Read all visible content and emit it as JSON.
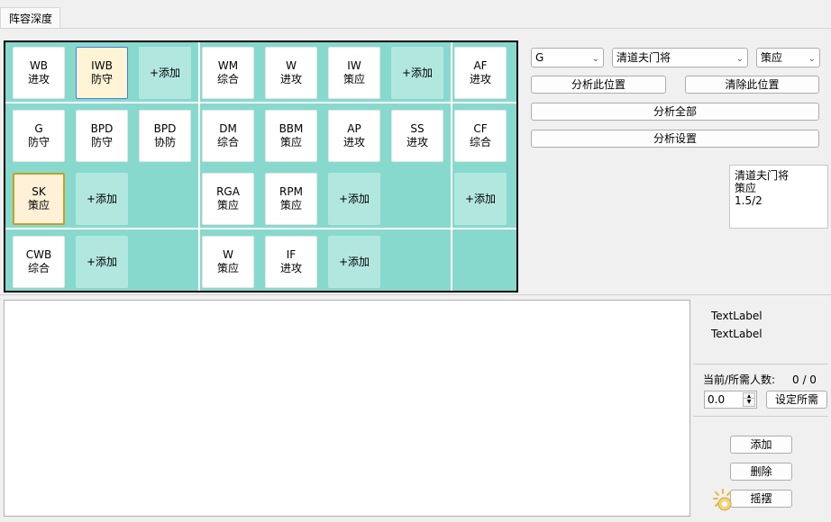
{
  "tab": {
    "label": "阵容深度"
  },
  "board": {
    "cells": [
      {
        "id": "c1",
        "line1": "WB",
        "line2": "进攻",
        "type": "player"
      },
      {
        "id": "c2",
        "line1": "IWB",
        "line2": "防守",
        "type": "selected-blue"
      },
      {
        "id": "c3",
        "line1": "+添加",
        "line2": "",
        "type": "add"
      },
      {
        "id": "c4",
        "line1": "WM",
        "line2": "综合",
        "type": "player"
      },
      {
        "id": "c5",
        "line1": "W",
        "line2": "进攻",
        "type": "player"
      },
      {
        "id": "c6",
        "line1": "IW",
        "line2": "策应",
        "type": "player"
      },
      {
        "id": "c7",
        "line1": "+添加",
        "line2": "",
        "type": "add"
      },
      {
        "id": "c8",
        "line1": "AF",
        "line2": "进攻",
        "type": "player"
      },
      {
        "id": "c9",
        "line1": "G",
        "line2": "防守",
        "type": "player"
      },
      {
        "id": "c10",
        "line1": "BPD",
        "line2": "防守",
        "type": "player"
      },
      {
        "id": "c11",
        "line1": "BPD",
        "line2": "协防",
        "type": "player"
      },
      {
        "id": "c12",
        "line1": "DM",
        "line2": "综合",
        "type": "player"
      },
      {
        "id": "c13",
        "line1": "BBM",
        "line2": "策应",
        "type": "player"
      },
      {
        "id": "c14",
        "line1": "AP",
        "line2": "进攻",
        "type": "player"
      },
      {
        "id": "c15",
        "line1": "SS",
        "line2": "进攻",
        "type": "player"
      },
      {
        "id": "c16",
        "line1": "CF",
        "line2": "综合",
        "type": "player"
      },
      {
        "id": "c17",
        "line1": "SK",
        "line2": "策应",
        "type": "selected-gold"
      },
      {
        "id": "c18",
        "line1": "+添加",
        "line2": "",
        "type": "add"
      },
      {
        "id": "c19",
        "line1": "RGA",
        "line2": "策应",
        "type": "player"
      },
      {
        "id": "c20",
        "line1": "RPM",
        "line2": "策应",
        "type": "player"
      },
      {
        "id": "c21",
        "line1": "+添加",
        "line2": "",
        "type": "add"
      },
      {
        "id": "c22",
        "line1": "+添加",
        "line2": "",
        "type": "add"
      },
      {
        "id": "c23",
        "line1": "CWB",
        "line2": "综合",
        "type": "player"
      },
      {
        "id": "c24",
        "line1": "+添加",
        "line2": "",
        "type": "add"
      },
      {
        "id": "c25",
        "line1": "W",
        "line2": "策应",
        "type": "player"
      },
      {
        "id": "c26",
        "line1": "IF",
        "line2": "进攻",
        "type": "player"
      },
      {
        "id": "c27",
        "line1": "+添加",
        "line2": "",
        "type": "add"
      }
    ]
  },
  "controls": {
    "position_select": "G",
    "role_select": "清道夫门将",
    "duty_select": "策应",
    "analyze_position": "分析此位置",
    "clear_position": "清除此位置",
    "analyze_all": "分析全部",
    "analyze_settings": "分析设置"
  },
  "info_box": {
    "line1": "清道夫门将",
    "line2": "策应",
    "line3": "1.5/2"
  },
  "side_panel": {
    "text_label_1": "TextLabel",
    "text_label_2": "TextLabel",
    "count_label": "当前/所需人数:",
    "count_value": "0 / 0",
    "spin_value": "0.0",
    "set_required": "设定所需",
    "add": "添加",
    "delete": "删除",
    "swing": "摇摆"
  },
  "colors": {
    "board_bg": "#87d9cd",
    "add_cell_bg": "#b2e7e0",
    "selected_blue_border": "#4a7be0",
    "selected_gold_border": "#c8a020"
  }
}
